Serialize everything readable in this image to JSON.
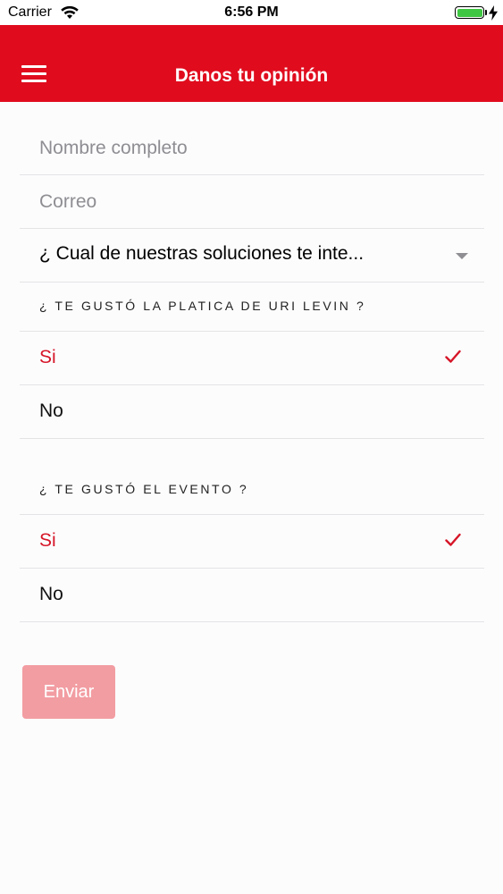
{
  "status_bar": {
    "carrier": "Carrier",
    "time": "6:56 PM",
    "battery_color": "#3fc642"
  },
  "header": {
    "title": "Danos tu opinión",
    "menu_icon": "hamburger-menu-icon",
    "background_color": "#e00c1e"
  },
  "form": {
    "name_placeholder": "Nombre completo",
    "email_placeholder": "Correo",
    "solutions_select": {
      "value": "¿ Cual de nuestras soluciones te inte...",
      "icon": "caret-down-icon"
    },
    "questions": [
      {
        "title": "¿ TE GUSTÓ LA PLATICA DE URI LEVIN ?",
        "options": [
          {
            "label": "Si",
            "selected": true
          },
          {
            "label": "No",
            "selected": false
          }
        ]
      },
      {
        "title": "¿ TE GUSTÓ EL EVENTO ?",
        "options": [
          {
            "label": "Si",
            "selected": true
          },
          {
            "label": "No",
            "selected": false
          }
        ]
      }
    ],
    "submit_label": "Enviar",
    "accent_color": "#d61628",
    "submit_color": "#f29da2"
  }
}
